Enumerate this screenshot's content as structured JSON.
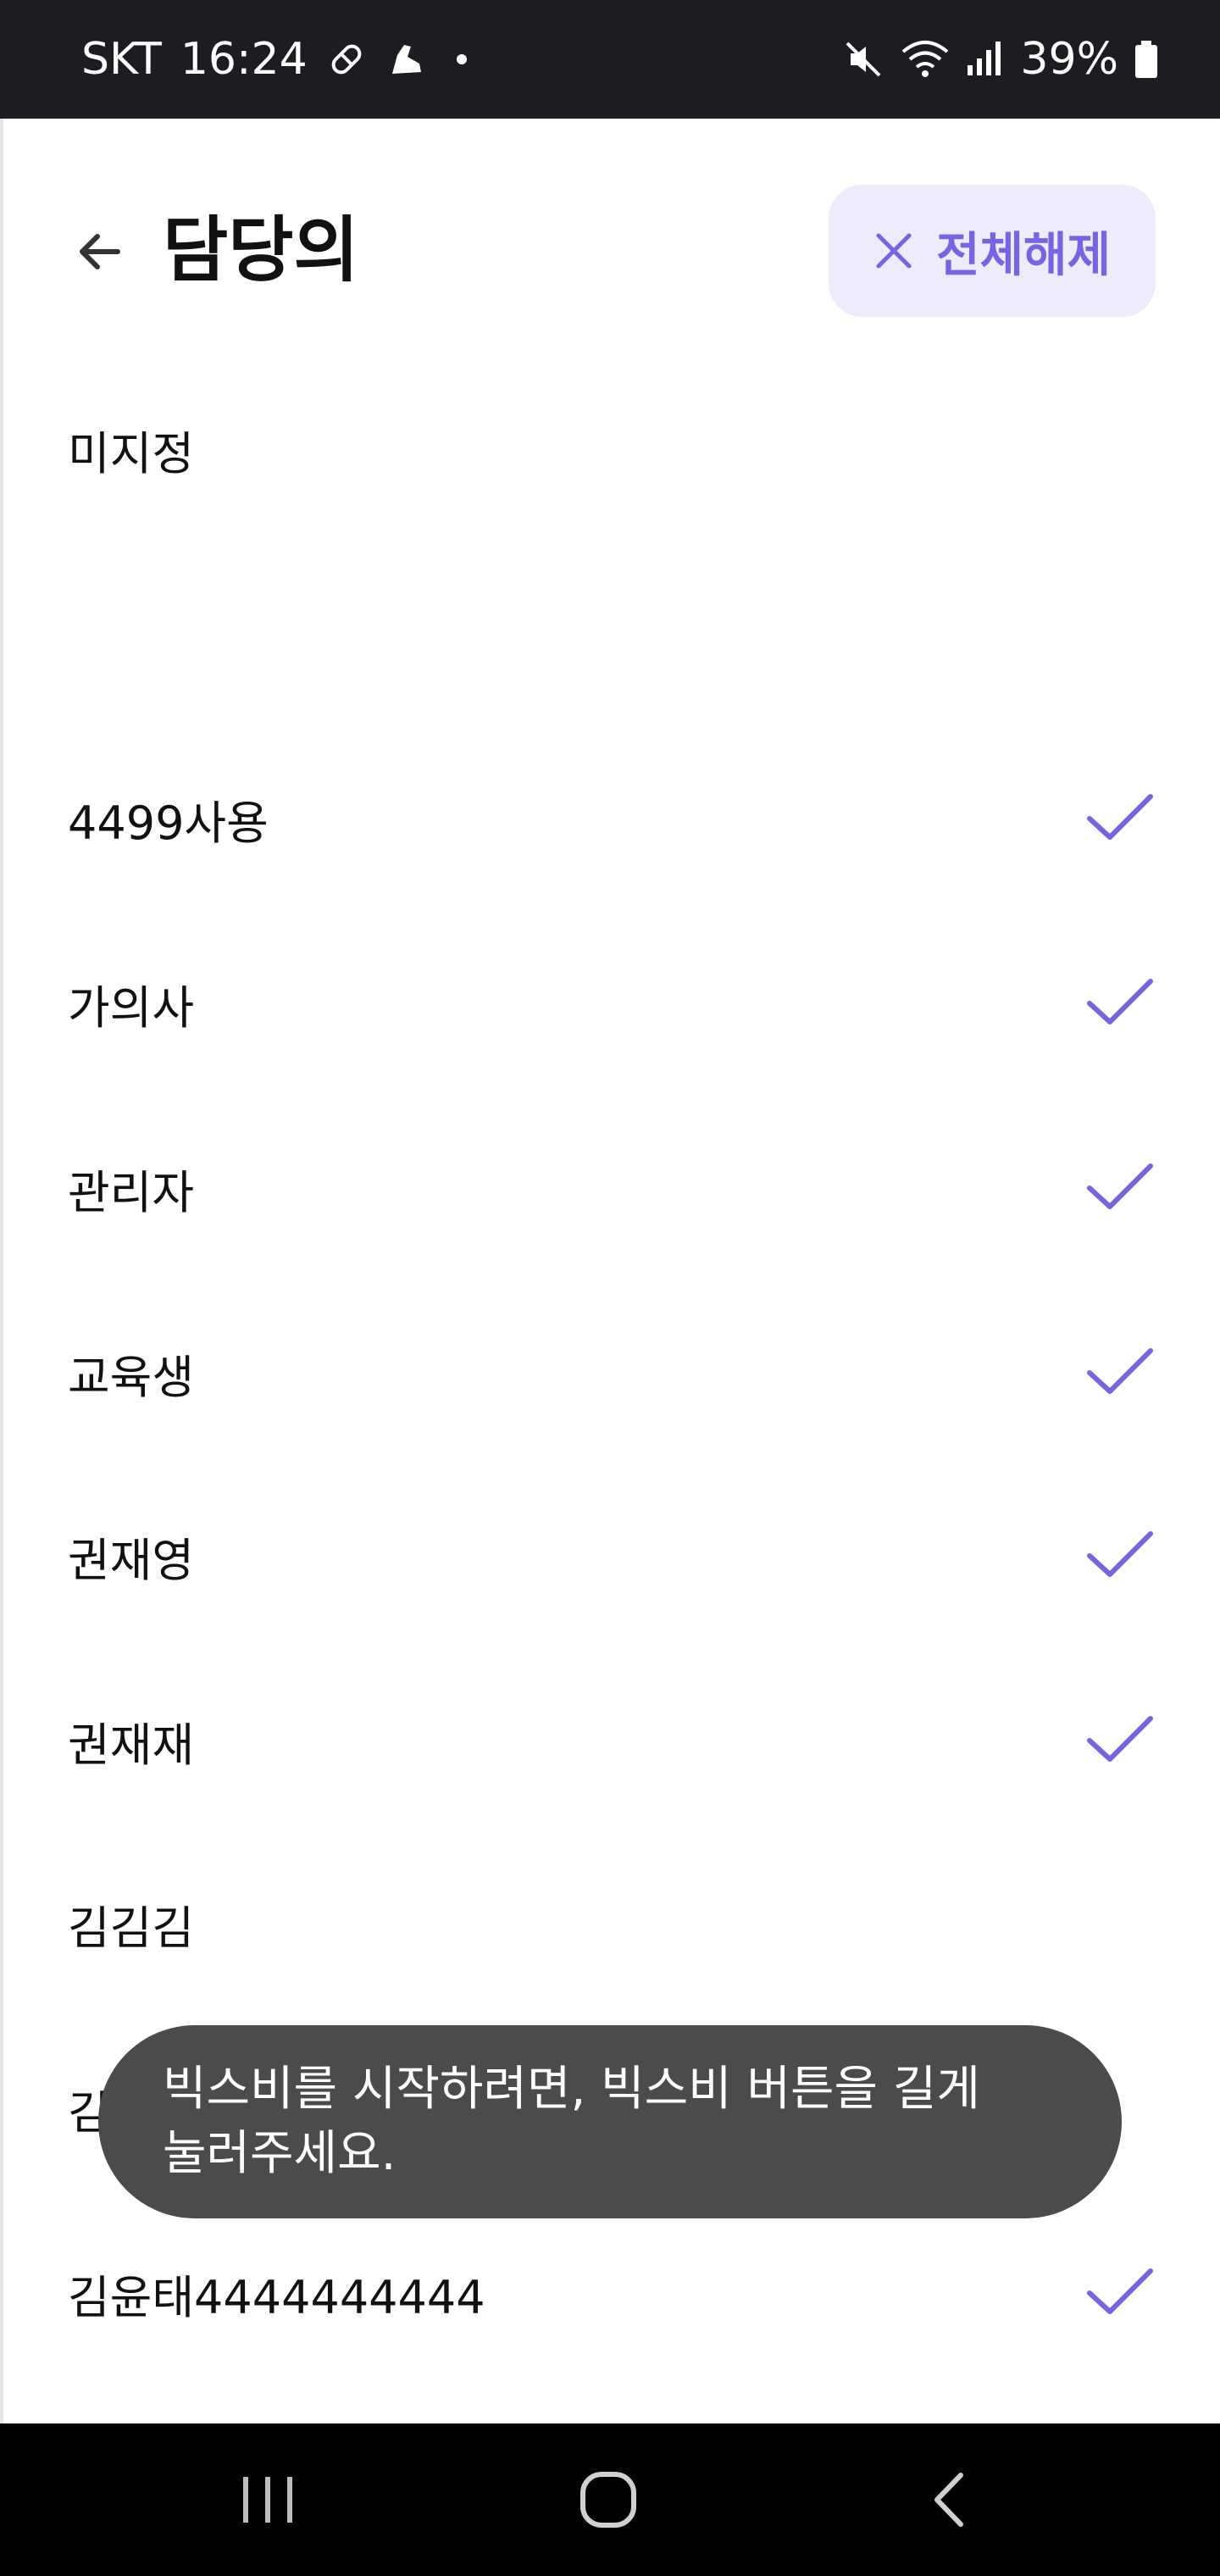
{
  "status_bar": {
    "carrier": "SKT",
    "time": "16:24",
    "battery": "39%",
    "left_icons": [
      "pill-icon",
      "shoe-icon",
      "dot-icon"
    ],
    "right_icons": [
      "mute-icon",
      "wifi-icon",
      "signal-icon",
      "battery-icon"
    ]
  },
  "header": {
    "title": "담당의",
    "back_icon": "back-arrow-icon",
    "clear_all_label": "전체해제",
    "clear_icon": "close-icon",
    "accent_color": "#7a63e0",
    "clear_bg": "#eeebfd"
  },
  "list": {
    "items": [
      {
        "label": "미지정",
        "checked": false
      },
      {
        "label": "",
        "checked": false
      },
      {
        "label": "4499사용",
        "checked": true
      },
      {
        "label": "가의사",
        "checked": true
      },
      {
        "label": "관리자",
        "checked": true
      },
      {
        "label": "교육생",
        "checked": true
      },
      {
        "label": "권재영",
        "checked": true
      },
      {
        "label": "권재재",
        "checked": true
      },
      {
        "label": "김김김",
        "checked": false
      },
      {
        "label": "김민준",
        "checked": false
      },
      {
        "label": "김윤태4444444444",
        "checked": true
      }
    ]
  },
  "toast": {
    "line1": "빅스비를 시작하려면, 빅스비 버튼을 길게",
    "line2": "눌러주세요."
  },
  "nav_bar": {
    "buttons": [
      "recent-apps-icon",
      "home-icon",
      "back-icon"
    ]
  }
}
